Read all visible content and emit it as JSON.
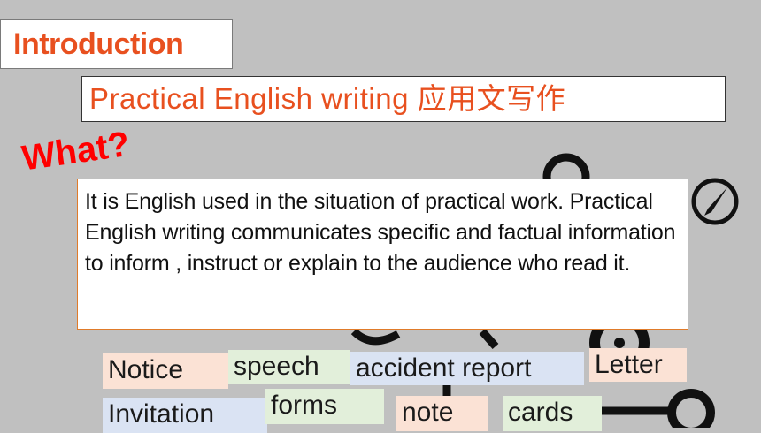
{
  "slide": {
    "heading": "Introduction",
    "title": "Practical  English  writing 应用文写作",
    "question": "What?",
    "definition": "  It is English used in the situation of practical work. Practical English writing communicates specific and factual information  to inform , instruct or explain to the audience who read it."
  },
  "tags": [
    {
      "label": "Notice",
      "color": "#fbe2d5"
    },
    {
      "label": "speech",
      "color": "#e2efda"
    },
    {
      "label": "accident  report",
      "color": "#dae3f3"
    },
    {
      "label": "Letter",
      "color": "#fbe2d5"
    },
    {
      "label": "Invitation",
      "color": "#dae3f3"
    },
    {
      "label": "forms",
      "color": "#e2efda"
    },
    {
      "label": "note",
      "color": "#fbe2d5"
    },
    {
      "label": "cards",
      "color": "#e2efda"
    }
  ],
  "colors": {
    "accent_orange": "#e8501f",
    "question_red": "#ff0000",
    "background": "#c0c0c0"
  },
  "icons": [
    "compass-icon",
    "network-diagram-decoration"
  ]
}
